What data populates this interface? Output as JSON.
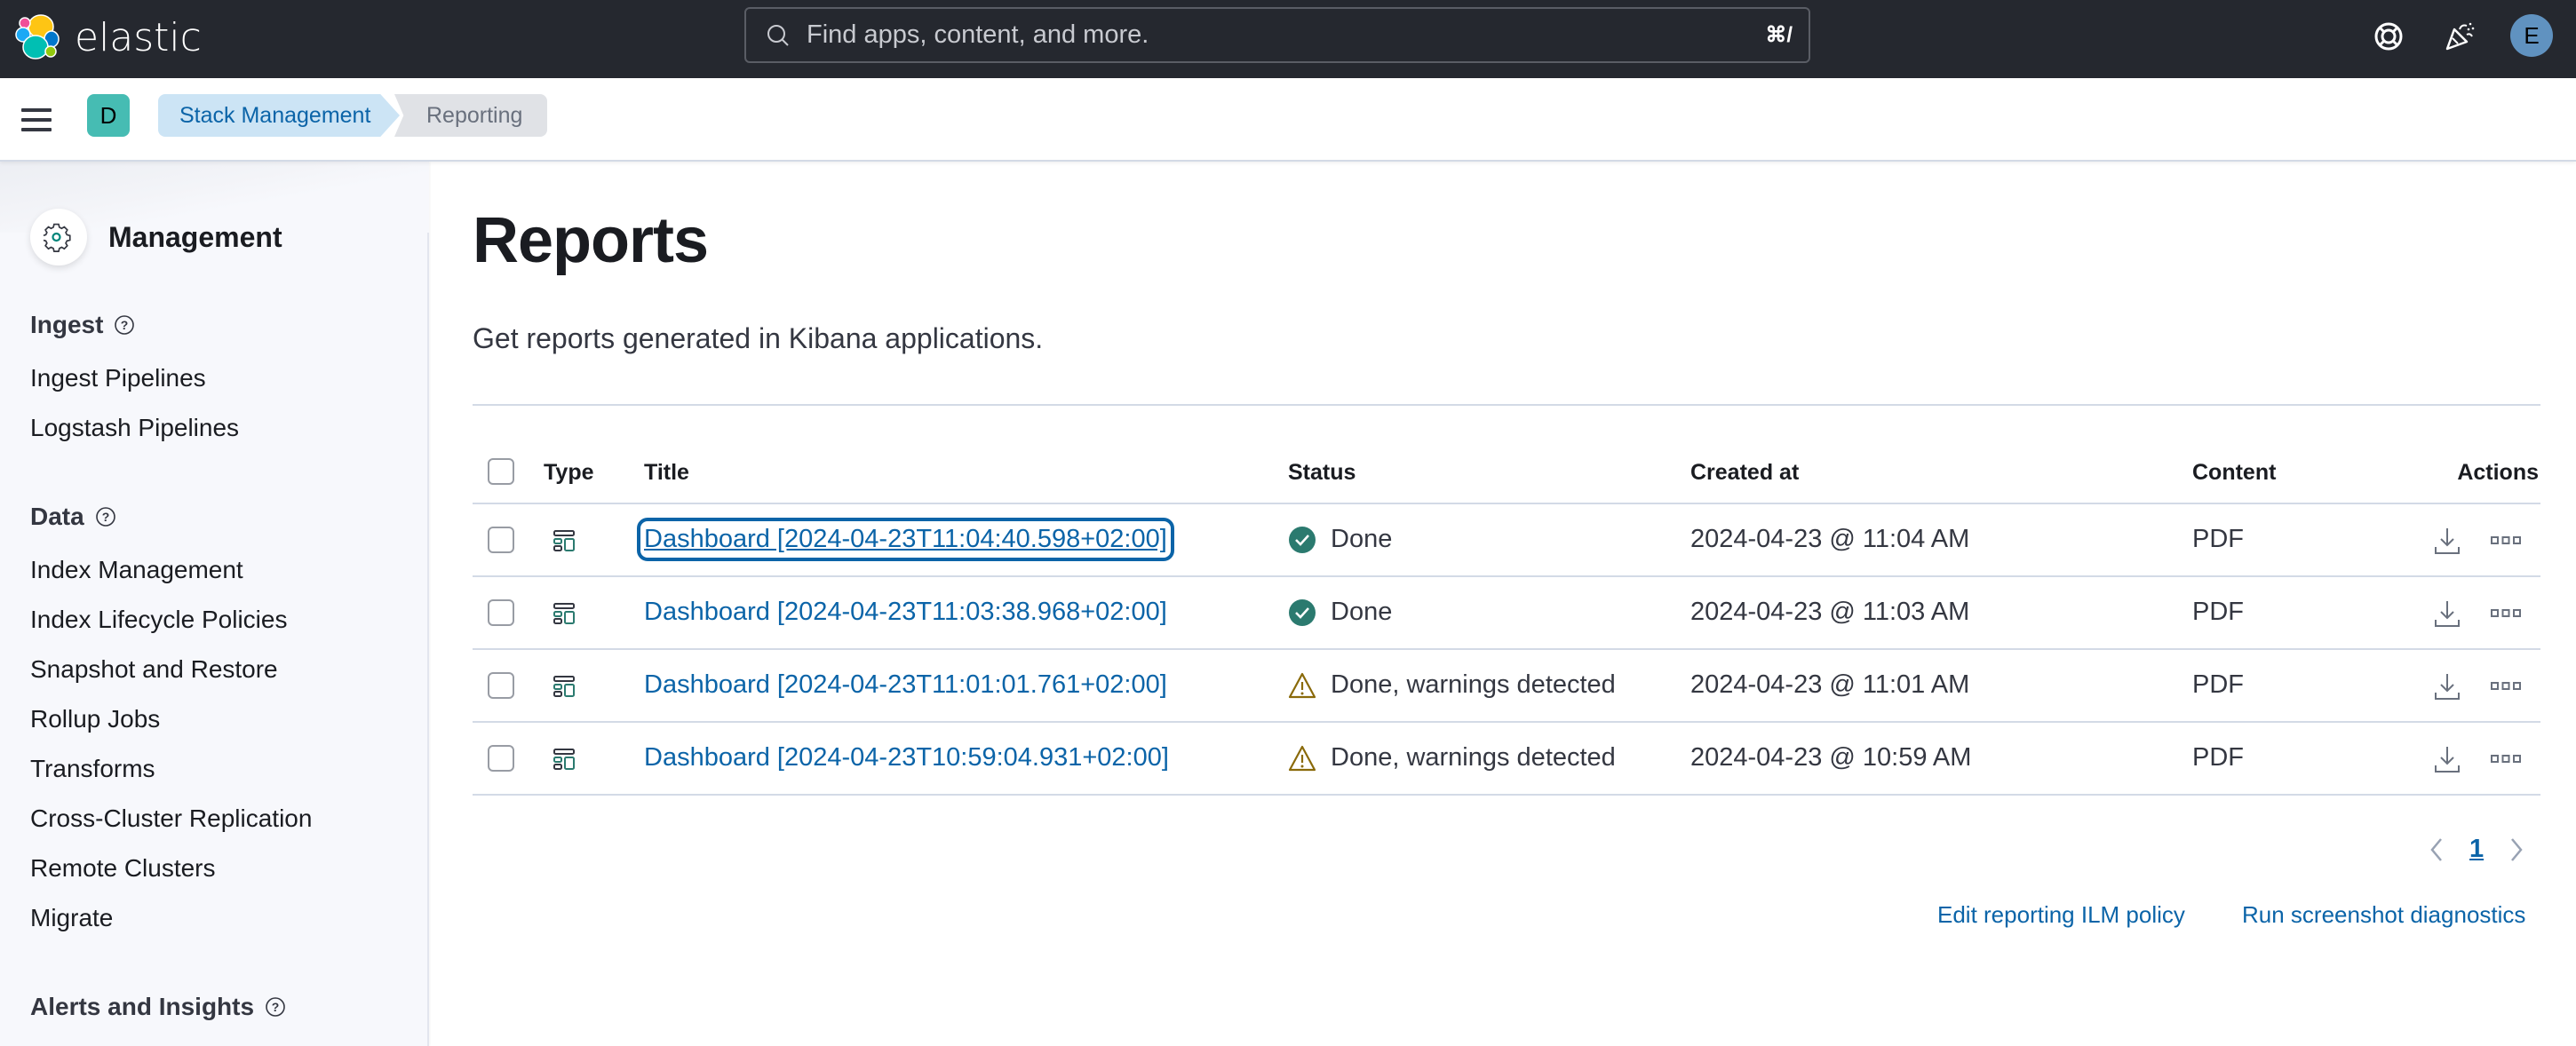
{
  "header": {
    "brand": "elastic",
    "search_placeholder": "Find apps, content, and more.",
    "search_shortcut": "⌘/",
    "help_icon": "help-lifebuoy-icon",
    "news_icon": "newsfeed-party-icon",
    "user_avatar": "E"
  },
  "breadcrumbs": {
    "space_avatar": "D",
    "items": [
      "Stack Management",
      "Reporting"
    ]
  },
  "sidebar": {
    "title": "Management",
    "sections": [
      {
        "label": "Ingest",
        "items": [
          "Ingest Pipelines",
          "Logstash Pipelines"
        ]
      },
      {
        "label": "Data",
        "items": [
          "Index Management",
          "Index Lifecycle Policies",
          "Snapshot and Restore",
          "Rollup Jobs",
          "Transforms",
          "Cross-Cluster Replication",
          "Remote Clusters",
          "Migrate"
        ]
      },
      {
        "label": "Alerts and Insights",
        "items": []
      }
    ]
  },
  "main": {
    "title": "Reports",
    "description": "Get reports generated in Kibana applications.",
    "table": {
      "columns": [
        "Type",
        "Title",
        "Status",
        "Created at",
        "Content",
        "Actions"
      ],
      "rows": [
        {
          "type": "dashboard",
          "title": "Dashboard [2024-04-23T11:04:40.598+02:00]",
          "status": "Done",
          "status_kind": "success",
          "created_at": "2024-04-23 @ 11:04 AM",
          "content": "PDF",
          "focused": true
        },
        {
          "type": "dashboard",
          "title": "Dashboard [2024-04-23T11:03:38.968+02:00]",
          "status": "Done",
          "status_kind": "success",
          "created_at": "2024-04-23 @ 11:03 AM",
          "content": "PDF",
          "focused": false
        },
        {
          "type": "dashboard",
          "title": "Dashboard [2024-04-23T11:01:01.761+02:00]",
          "status": "Done, warnings detected",
          "status_kind": "warning",
          "created_at": "2024-04-23 @ 11:01 AM",
          "content": "PDF",
          "focused": false
        },
        {
          "type": "dashboard",
          "title": "Dashboard [2024-04-23T10:59:04.931+02:00]",
          "status": "Done, warnings detected",
          "status_kind": "warning",
          "created_at": "2024-04-23 @ 10:59 AM",
          "content": "PDF",
          "focused": false
        }
      ]
    },
    "pagination": {
      "current_page": "1"
    },
    "footer_links": [
      "Edit reporting ILM policy",
      "Run screenshot diagnostics"
    ]
  },
  "colors": {
    "header_bg": "#25282f",
    "link": "#0b64a8",
    "success": "#2b7a6f",
    "warning": "#8a6a0a",
    "space_avatar": "#46bcb3",
    "user_avatar": "#6092c0"
  }
}
